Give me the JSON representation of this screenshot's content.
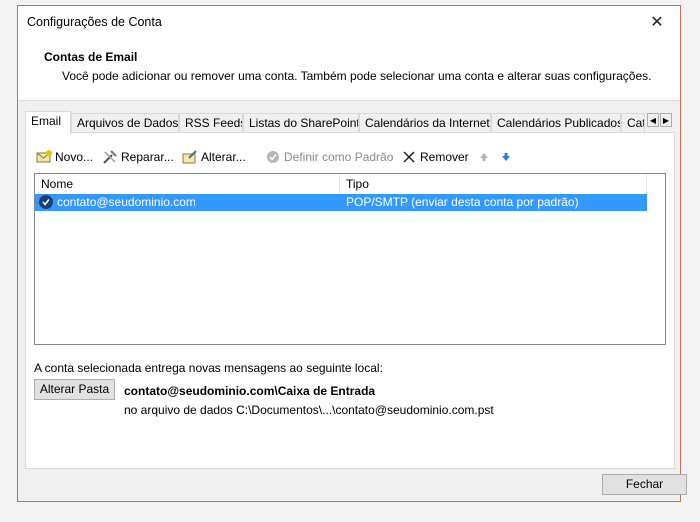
{
  "window": {
    "title": "Configurações de Conta",
    "close_symbol": "✕"
  },
  "header": {
    "title": "Contas de Email",
    "description": "Você pode adicionar ou remover uma conta. Também pode selecionar uma conta e alterar suas configurações."
  },
  "tabs": [
    {
      "label": "Email",
      "active": true
    },
    {
      "label": "Arquivos de Dados"
    },
    {
      "label": "RSS Feeds"
    },
    {
      "label": "Listas do SharePoint"
    },
    {
      "label": "Calendários da Internet"
    },
    {
      "label": "Calendários Publicados"
    },
    {
      "label": "Catálogos de Endereços"
    }
  ],
  "toolbar": {
    "new_label": "Novo...",
    "repair_label": "Reparar...",
    "change_label": "Alterar...",
    "set_default_label": "Definir como Padrão",
    "remove_label": "Remover"
  },
  "account_list": {
    "columns": [
      "Nome",
      "Tipo"
    ],
    "rows": [
      {
        "name": "contato@seudominio.com",
        "type": "POP/SMTP (enviar desta conta por padrão)",
        "selected": true,
        "default": true
      }
    ]
  },
  "delivery": {
    "label": "A conta selecionada entrega novas mensagens ao seguinte local:",
    "change_folder_label": "Alterar Pasta",
    "folder_path": "contato@seudominio.com\\Caixa de Entrada",
    "data_file": "no arquivo de dados C:\\Documentos\\...\\contato@seudominio.com.pst"
  },
  "footer": {
    "close_label": "Fechar"
  },
  "colors": {
    "selection": "#3399ff",
    "accent_border": "#d46a4a",
    "arrow_blue": "#2b7cd3"
  }
}
